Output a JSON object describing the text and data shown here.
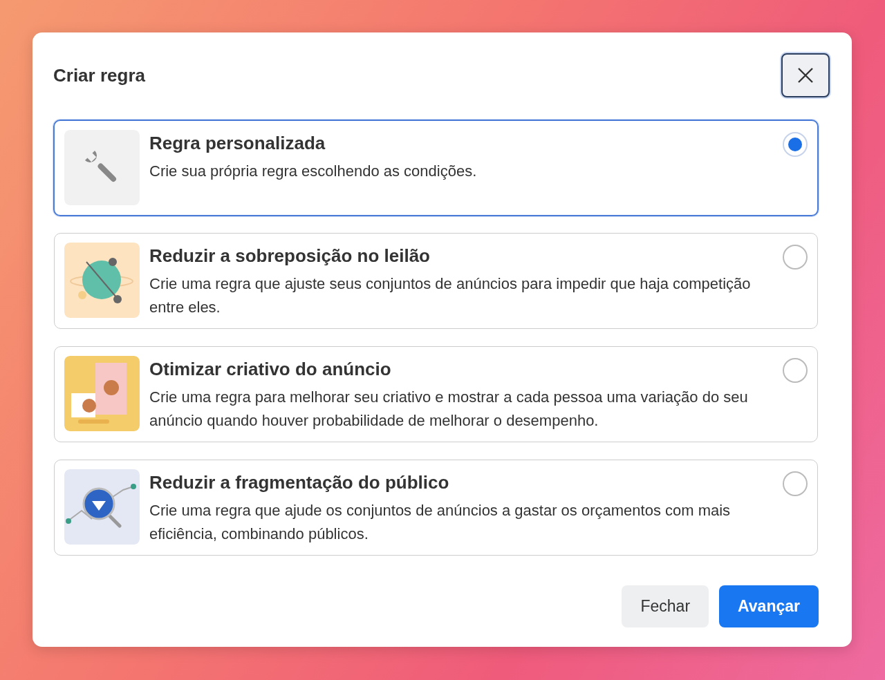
{
  "dialog": {
    "title": "Criar regra"
  },
  "options": [
    {
      "kind": "wrench",
      "title": "Regra personalizada",
      "description": "Crie sua própria regra escolhendo as condições.",
      "selected": true
    },
    {
      "kind": "globe",
      "title": "Reduzir a sobreposição no leilão",
      "description": "Crie uma regra que ajuste seus conjuntos de anúncios para impedir que haja competição entre eles.",
      "selected": false
    },
    {
      "kind": "teapot",
      "title": "Otimizar criativo do anúncio",
      "description": "Crie uma regra para melhorar seu criativo e mostrar a cada pessoa uma variação do seu anúncio quando houver probabilidade de melhorar o desempenho.",
      "selected": false
    },
    {
      "kind": "magnifier",
      "title": "Reduzir a fragmentação do público",
      "description": "Crie uma regra que ajude os conjuntos de anúncios a gastar os orçamentos com mais eficiência, combinando públicos.",
      "selected": false
    }
  ],
  "buttons": [
    {
      "kind": "secondary",
      "label": "Fechar"
    },
    {
      "kind": "primary",
      "label": "Avançar"
    }
  ]
}
